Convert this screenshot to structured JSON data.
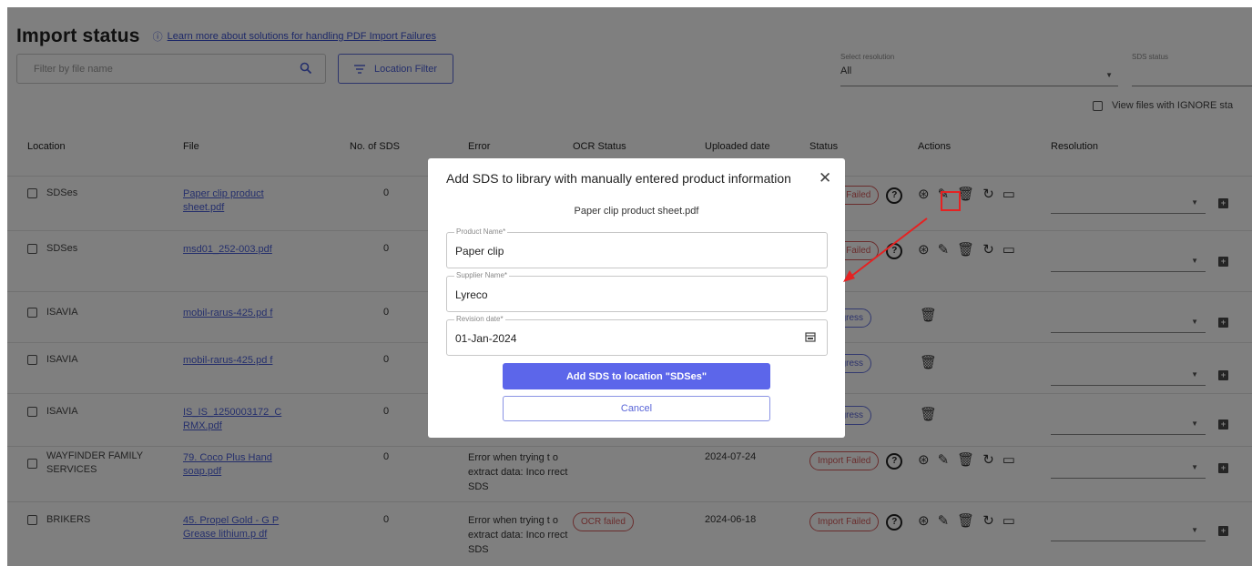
{
  "header": {
    "title": "Import status",
    "learn_link": "Learn more about solutions for handling PDF Import Failures"
  },
  "filters": {
    "search_placeholder": "Filter by file name",
    "location_filter_label": "Location Filter",
    "select_resolution_label": "Select resolution",
    "select_resolution_value": "All",
    "sds_status_label": "SDS status",
    "ignore_label": "View files with IGNORE sta"
  },
  "table": {
    "headers": [
      "Location",
      "File",
      "No. of SDS",
      "Error",
      "OCR Status",
      "Uploaded date",
      "Status",
      "Actions",
      "Resolution"
    ],
    "rows": [
      {
        "location": "SDSes",
        "file": "Paper clip product sheet.pdf",
        "sds": "0",
        "error": "",
        "ocr": "",
        "date": "",
        "status": "Import Failed"
      },
      {
        "location": "SDSes",
        "file": "msd01_252-003.pdf",
        "sds": "0",
        "error": "",
        "ocr": "",
        "date": "",
        "status": "Import Failed"
      },
      {
        "location": "ISAVIA",
        "file": "mobil-rarus-425.pd f",
        "sds": "0",
        "error": "",
        "ocr": "",
        "date": "",
        "status": "In progress"
      },
      {
        "location": "ISAVIA",
        "file": "mobil-rarus-425.pd f",
        "sds": "0",
        "error": "",
        "ocr": "",
        "date": "",
        "status": "In progress"
      },
      {
        "location": "ISAVIA",
        "file": "IS_IS_1250003172_C RMX.pdf",
        "sds": "0",
        "error": "",
        "ocr": "",
        "date": "",
        "status": "In progress"
      },
      {
        "location": "WAYFINDER FAMILY SERVICES",
        "file": "79. Coco Plus Hand soap.pdf",
        "sds": "0",
        "error": "Error when trying t o extract data: Inco rrect SDS",
        "ocr": "",
        "date": "2024-07-24",
        "status": "Import Failed"
      },
      {
        "location": "BRIKERS",
        "file": "45. Propel Gold - G P Grease lithium.p df",
        "sds": "0",
        "error": "Error when trying t o extract data: Inco rrect SDS",
        "ocr": "OCR failed",
        "date": "2024-06-18",
        "status": "Import Failed"
      }
    ]
  },
  "modal": {
    "title": "Add SDS to library with manually entered product information",
    "filename": "Paper clip product sheet.pdf",
    "product_label": "Product Name*",
    "product_value": "Paper clip",
    "supplier_label": "Supplier Name*",
    "supplier_value": "Lyreco",
    "revision_label": "Revision date*",
    "revision_value": "01-Jan-2024",
    "add_button": "Add SDS to location \"SDSes\"",
    "cancel_button": "Cancel"
  },
  "colors": {
    "accent": "#5c66ea",
    "failed": "#d45b5b",
    "highlight": "#e52222"
  }
}
